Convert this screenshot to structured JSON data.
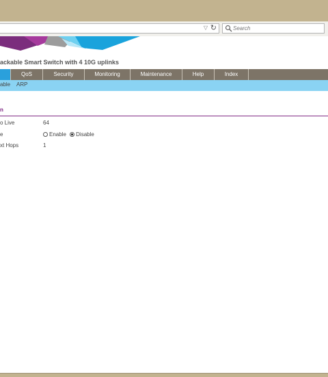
{
  "browser": {
    "search_placeholder": "Search",
    "url": ""
  },
  "header": {
    "product_title": "ackable Smart Switch with 4 10G uplinks"
  },
  "main_nav": {
    "items": [
      "",
      "QoS",
      "Security",
      "Monitoring",
      "Maintenance",
      "Help",
      "Index"
    ],
    "active": 0
  },
  "sub_nav": {
    "items": [
      "able",
      "ARP"
    ]
  },
  "section": {
    "tab_label": "n"
  },
  "settings": {
    "ttl_label": "o Live",
    "ttl_value": "64",
    "mode_label": "e",
    "mode_enable": "Enable",
    "mode_disable": "Disable",
    "mode_selected": "Disable",
    "hops_label": "xt Hops",
    "hops_value": "1"
  },
  "colors": {
    "nav_bg": "#7d7467",
    "nav_active": "#2aa0dc",
    "subnav_bg": "#8ad3f3",
    "section_accent": "#7d2481",
    "chrome": "#c2b38f"
  }
}
